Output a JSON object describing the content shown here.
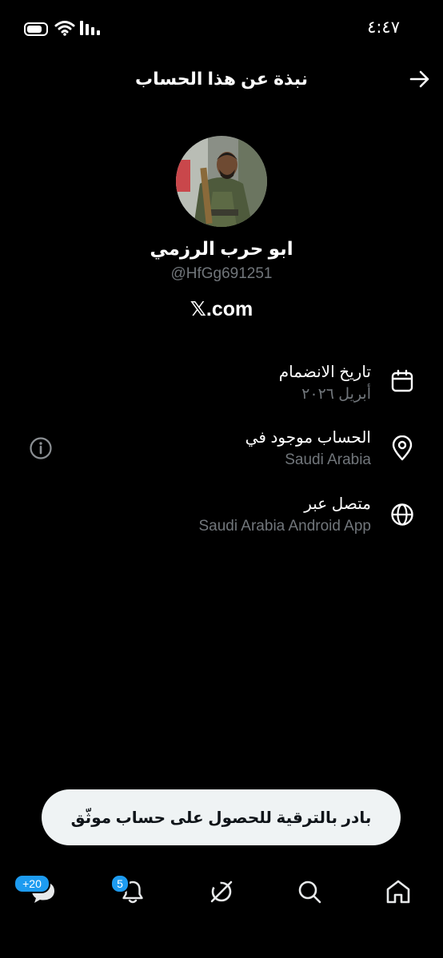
{
  "status_bar": {
    "time": "٤:٤٧"
  },
  "header": {
    "title": "نبذة عن هذا الحساب"
  },
  "profile": {
    "display_name": "ابو حرب الرزمي",
    "handle": "@HfGg691251",
    "domain": "𝕏.com"
  },
  "info_rows": [
    {
      "icon": "calendar-icon",
      "label": "تاريخ الانضمام",
      "value": "أبريل ٢٠٢٦"
    },
    {
      "icon": "location-pin-icon",
      "label": "الحساب موجود في",
      "value": "Saudi Arabia"
    },
    {
      "icon": "globe-icon",
      "label": "متصل عبر",
      "value": "Saudi Arabia Android App"
    }
  ],
  "upgrade_button": {
    "label": "بادر بالترقية للحصول على حساب موثّق"
  },
  "bottom_nav": {
    "messages_badge": "+20",
    "notifications_badge": "5",
    "items": [
      "messages-icon",
      "notifications-icon",
      "grok-icon",
      "search-icon",
      "home-icon"
    ]
  }
}
